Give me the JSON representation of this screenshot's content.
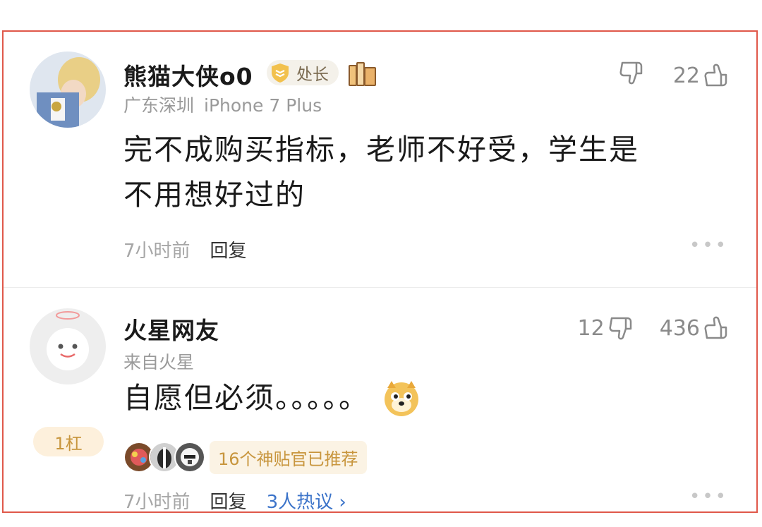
{
  "comments": [
    {
      "username": "熊猫大侠o0",
      "badge": "处长",
      "location": "广东深圳",
      "device": "iPhone 7 Plus",
      "text_line1": "完不成购买指标，老师不好受，学生是",
      "text_line2": "不用想好过的",
      "time": "7小时前",
      "reply": "回复",
      "like_count": "22"
    },
    {
      "username": "火星网友",
      "location": "来自火星",
      "text": "自愿但必须。。。。。",
      "floor": "1杠",
      "recommend": "16个神贴官已推荐",
      "time": "7小时前",
      "reply": "回复",
      "hot": "3人热议 ›",
      "dislike_count": "12",
      "like_count": "436"
    }
  ],
  "more": "•••",
  "colors": {
    "frame": "#e0584a",
    "link": "#3b73c9",
    "gold": "#c8963e"
  }
}
